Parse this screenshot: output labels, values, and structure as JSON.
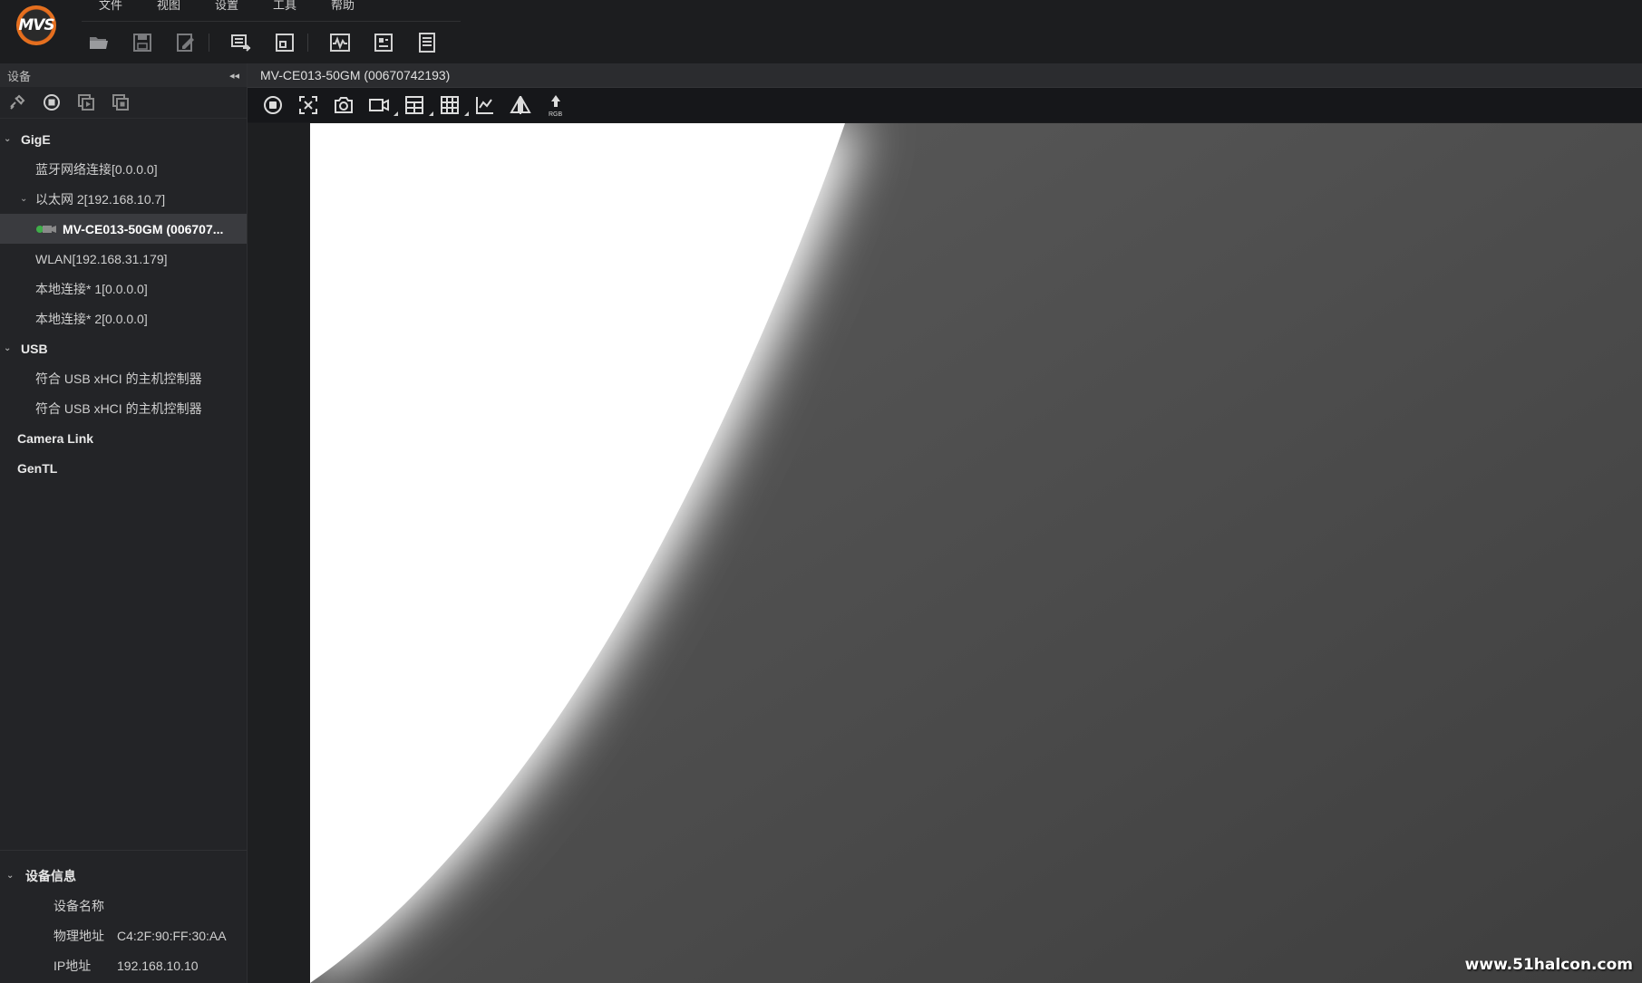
{
  "app": {
    "logo_text": "MVS"
  },
  "menu": [
    "文件",
    "视图",
    "设置",
    "工具",
    "帮助"
  ],
  "toolbar": {
    "icons": [
      "open-folder-icon",
      "save-icon",
      "save-as-icon",
      "multi-device-icon",
      "fullscreen-icon",
      "waveform-icon",
      "properties-icon",
      "log-icon"
    ]
  },
  "device_panel": {
    "title": "设备",
    "collapse_glyph": "◂◂",
    "tree": {
      "gige": {
        "label": "GigE",
        "children": {
          "bluetooth": "蓝牙网络连接[0.0.0.0]",
          "ethernet2": "以太网 2[192.168.10.7]",
          "camera": "MV-CE013-50GM (006707...",
          "wlan": "WLAN[192.168.31.179]",
          "local1": "本地连接* 1[0.0.0.0]",
          "local2": "本地连接* 2[0.0.0.0]"
        }
      },
      "usb": {
        "label": "USB",
        "children": [
          "符合 USB xHCI 的主机控制器",
          "符合 USB xHCI 的主机控制器"
        ]
      },
      "camera_link": "Camera Link",
      "gentl": "GenTL"
    }
  },
  "device_info": {
    "title": "设备信息",
    "rows": [
      {
        "key": "设备名称",
        "value": ""
      },
      {
        "key": "物理地址",
        "value": "C4:2F:90:FF:30:AA"
      },
      {
        "key": "IP地址",
        "value": "192.168.10.10"
      }
    ]
  },
  "main": {
    "tab_title": "MV-CE013-50GM (00670742193)",
    "rgb_label": "RGB",
    "watermark": "www.51halcon.com"
  },
  "colors": {
    "background": "#1e1f21",
    "panel": "#232427",
    "selected_row": "#3a3b3f",
    "accent_orange": "#e36a1c",
    "camera_green": "#3fae49"
  }
}
